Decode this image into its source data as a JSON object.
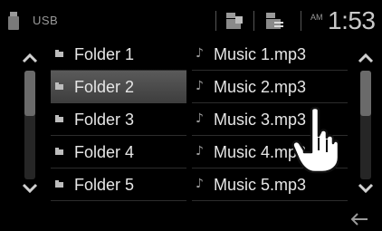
{
  "status_bar": {
    "source": "USB",
    "ampm": "AM",
    "time": "1:53",
    "icons": [
      "usb-device-icon",
      "folder-view-icon",
      "folder-list-icon"
    ]
  },
  "folders": [
    {
      "label": "Folder 1",
      "selected": false
    },
    {
      "label": "Folder 2",
      "selected": true
    },
    {
      "label": "Folder 3",
      "selected": false
    },
    {
      "label": "Folder 4",
      "selected": false
    },
    {
      "label": "Folder 5",
      "selected": false
    }
  ],
  "tracks": [
    {
      "label": "Music 1.mp3"
    },
    {
      "label": "Music 2.mp3"
    },
    {
      "label": "Music 3.mp3"
    },
    {
      "label": "Music 4.mp3"
    },
    {
      "label": "Music 5.mp3"
    }
  ],
  "colors": {
    "background": "#000000",
    "selected_row": "#4c4c4c",
    "text": "#e6e6e6",
    "muted_text": "#9a9a9a"
  },
  "icons": {
    "scroll_up": "chevron-up-icon",
    "scroll_down": "chevron-down-icon",
    "back": "back-arrow-icon",
    "pointer": "hand-pointer-icon"
  }
}
